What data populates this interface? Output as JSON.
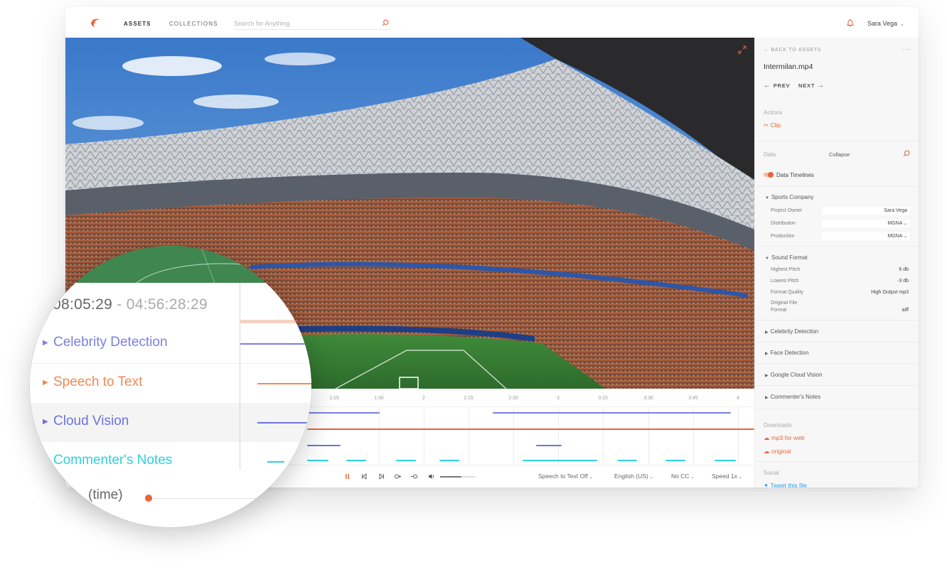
{
  "topbar": {
    "logo": "dolphin-logo",
    "nav": [
      {
        "label": "ASSETS",
        "active": true
      },
      {
        "label": "COLLECTIONS",
        "active": false
      }
    ],
    "search": {
      "placeholder": "Search for Anything",
      "value": "",
      "icon": "search-icon"
    },
    "notifications_icon": "bell-icon",
    "user": {
      "name": "Sara Vega",
      "icon": "chevron-down-icon"
    }
  },
  "video": {
    "icon": "expand-icon"
  },
  "timeline": {
    "ticks": [
      "1:15",
      "1:30",
      "2",
      "2:15",
      "2:30",
      "3",
      "3:15",
      "3:30",
      "3:45",
      "4"
    ]
  },
  "controls": {
    "icons": [
      "pause-icon",
      "step-back-icon",
      "step-forward-icon",
      "zoom-in-icon",
      "zoom-out-icon",
      "volume-icon"
    ],
    "volume_level": 0.6,
    "speech_to_text": "Speech to Text Off",
    "language": "English (US)",
    "captions": "No CC",
    "speed": "Speed 1x"
  },
  "sidebar": {
    "back_label": "BACK TO ASSETS",
    "more": "···",
    "file_name": "Intermilan.mp4",
    "prev_label": "PREV",
    "next_label": "NEXT",
    "actions_label": "Actions",
    "clip_label": "Clip",
    "data_label": "Data",
    "collapse_label": "Collapse",
    "data_timelines_label": "Data Timelines",
    "data_timelines_on": true,
    "sports_company": {
      "title": "Sports Company",
      "project_owner_key": "Project Owner",
      "project_owner": "Sara Vega",
      "distribution_key": "Distribution",
      "distribution": "MGNA",
      "production_key": "Production",
      "production": "MGNA"
    },
    "sound_format": {
      "title": "Sound Format",
      "highest_pitch_key": "Highest Pitch",
      "highest_pitch": "6 db",
      "lowest_pitch_key": "Lowest Pitch",
      "lowest_pitch": "-3 db",
      "format_quality_key": "Format Quality",
      "format_quality": "High Output mp3",
      "original_key_1": "Original File",
      "original_key_2": "Format",
      "original_format": "aiff"
    },
    "groups": [
      "Celebrity Detection",
      "Face Detection",
      "Google Cloud Vision",
      "Commenter's Notes"
    ],
    "downloads_label": "Downloads",
    "downloads": [
      "mp3 for web",
      "original"
    ],
    "social_label": "Social",
    "tweet_label": "Tweet this file"
  },
  "magnifier": {
    "time_start": "08:05:29",
    "time_sep": "-",
    "time_end": "04:56:28:29",
    "rows": [
      {
        "label": "Celebrity Detection",
        "color": "#7b7fe0"
      },
      {
        "label": "Speech to Text",
        "color": "#ef8a55"
      },
      {
        "label": "Cloud Vision",
        "color": "#6e72dd"
      },
      {
        "label": "Commenter's Notes",
        "color": "#2fd0e0"
      }
    ],
    "time_label": "(time)"
  },
  "colors": {
    "accent": "#e8643a",
    "twitter": "#1da1f2"
  }
}
